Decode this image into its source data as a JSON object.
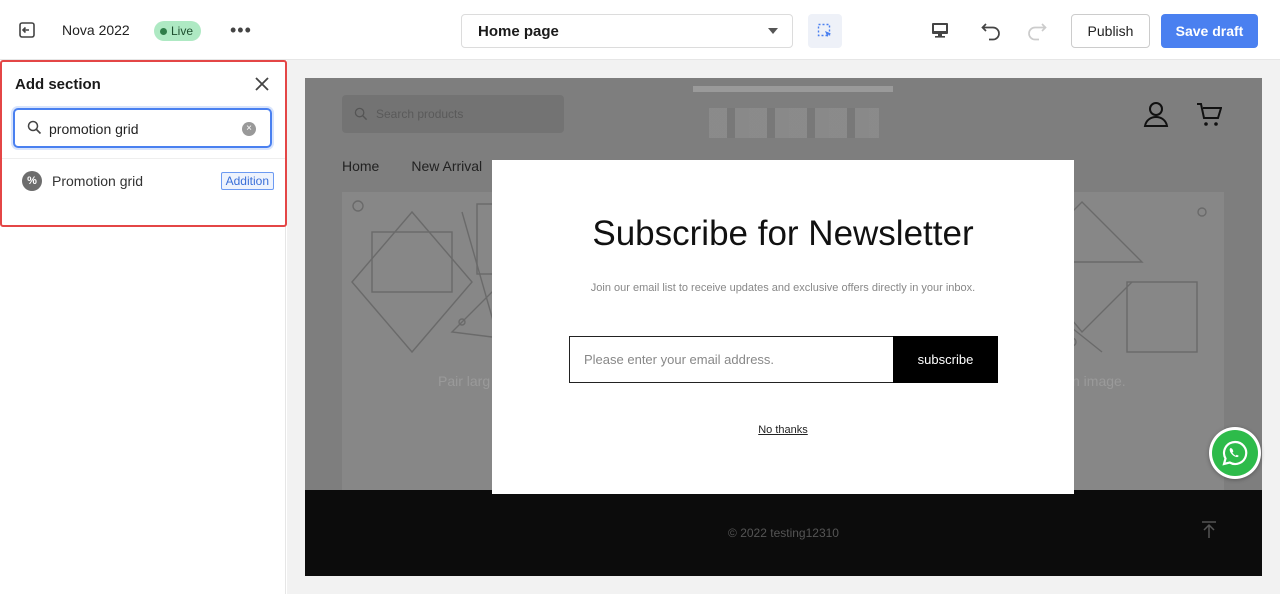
{
  "topbar": {
    "store_name": "Nova 2022",
    "live_label": "Live",
    "more_label": "•••",
    "page_select_value": "Home page",
    "publish_label": "Publish",
    "save_draft_label": "Save draft"
  },
  "sidebar": {
    "panel_title": "Add section",
    "search_value": "promotion grid",
    "results": [
      {
        "label": "Promotion grid",
        "badge": "Addition",
        "icon": "percent-badge-icon"
      }
    ]
  },
  "preview": {
    "search_placeholder": "Search products",
    "nav": [
      "Home",
      "New Arrival"
    ],
    "hero_text_left": "Pair larg",
    "hero_text_right": "n image.",
    "copyright": "© 2022 testing12310"
  },
  "modal": {
    "title": "Subscribe for Newsletter",
    "subtitle": "Join our email list to receive updates and exclusive offers directly in your inbox.",
    "email_placeholder": "Please enter your email address.",
    "subscribe_label": "subscribe",
    "no_thanks_label": "No thanks"
  },
  "colors": {
    "accent": "#4a80f0",
    "live_badge": "#aee9c3",
    "highlight_border": "#e44646",
    "whatsapp": "#2dbb4a"
  }
}
